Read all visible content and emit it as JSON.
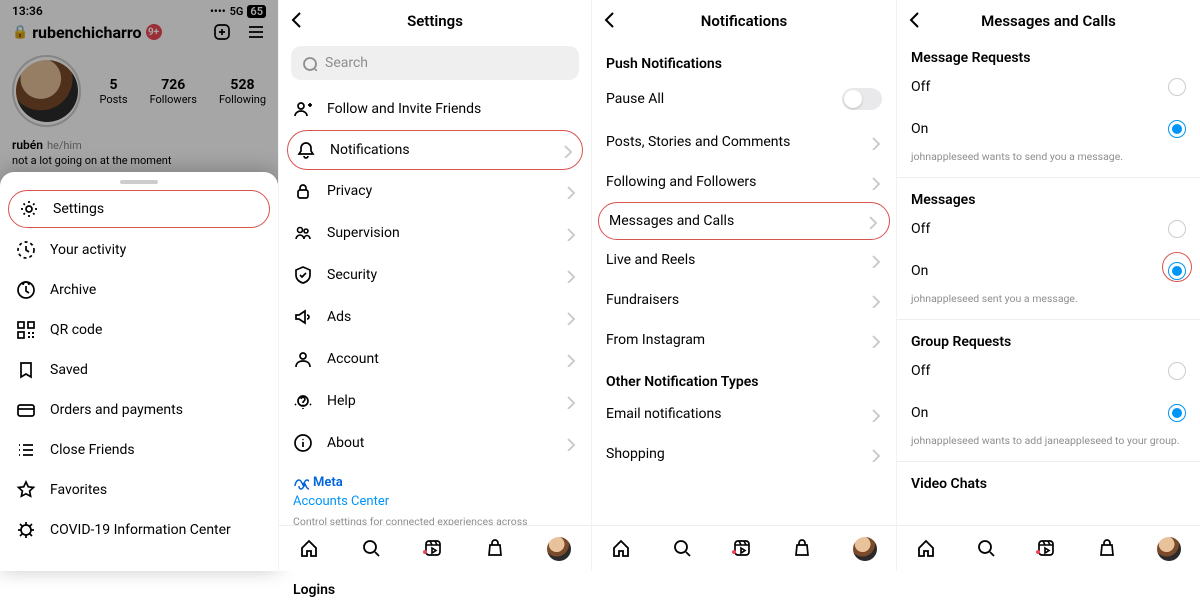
{
  "col1": {
    "status_time": "13:36",
    "status_net": "5G",
    "status_batt": "65",
    "username": "rubenchicharro",
    "badge": "9+",
    "stats": [
      {
        "n": "5",
        "lbl": "Posts"
      },
      {
        "n": "726",
        "lbl": "Followers"
      },
      {
        "n": "528",
        "lbl": "Following"
      }
    ],
    "bio_name": "rubén",
    "bio_pron": "he/him",
    "bio_line": "not a lot going on at the moment",
    "sheet": [
      "Settings",
      "Your activity",
      "Archive",
      "QR code",
      "Saved",
      "Orders and payments",
      "Close Friends",
      "Favorites",
      "COVID-19 Information Center"
    ]
  },
  "col2": {
    "title": "Settings",
    "search": "Search",
    "items": [
      "Follow and Invite Friends",
      "Notifications",
      "Privacy",
      "Supervision",
      "Security",
      "Ads",
      "Account",
      "Help",
      "About"
    ],
    "meta_brand": "Meta",
    "meta_link": "Accounts Center",
    "meta_desc": "Control settings for connected experiences across Instagram, the Facebook app and Messenger, including story and post sharing and logging in.",
    "logins": "Logins"
  },
  "col3": {
    "title": "Notifications",
    "push_header": "Push Notifications",
    "items": [
      "Pause All",
      "Posts, Stories and Comments",
      "Following and Followers",
      "Messages and Calls",
      "Live and Reels",
      "Fundraisers",
      "From Instagram"
    ],
    "other_header": "Other Notification Types",
    "other_items": [
      "Email notifications",
      "Shopping"
    ]
  },
  "col4": {
    "title": "Messages and Calls",
    "sections": [
      {
        "header": "Message Requests",
        "off": "Off",
        "on": "On",
        "sub": "johnappleseed wants to send you a message."
      },
      {
        "header": "Messages",
        "off": "Off",
        "on": "On",
        "sub": "johnappleseed sent you a message."
      },
      {
        "header": "Group Requests",
        "off": "Off",
        "on": "On",
        "sub": "johnappleseed wants to add janeappleseed to your group."
      },
      {
        "header": "Video Chats"
      }
    ]
  }
}
